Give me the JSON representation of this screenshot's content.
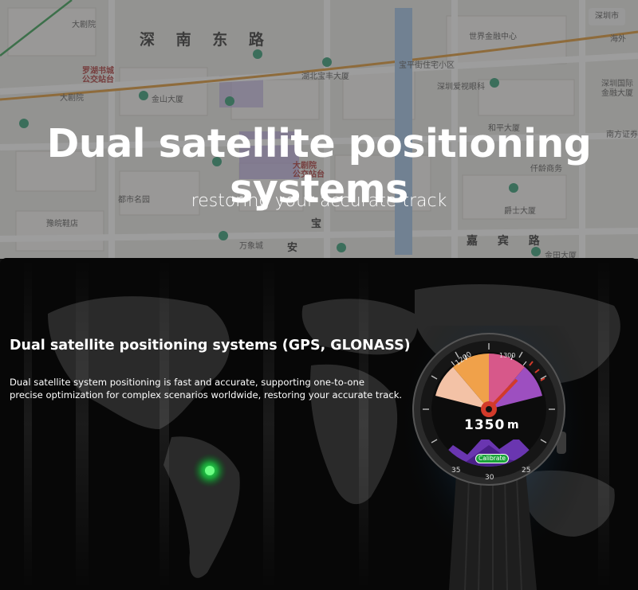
{
  "hero": {
    "title": "Dual satellite positioning systems",
    "subtitle": "restoring your accurate track",
    "map_city_button": "深圳市",
    "map_labels": {
      "road_shennan": "深 南 东 路",
      "road_jiabin": "嘉 宾 路",
      "hospital": "大剧院",
      "hospital2": "大剧院",
      "bookcity": "罗湖书城\n公交站台",
      "jinshan": "金山大厦",
      "world_finance": "世界金融中心",
      "baoping": "宝平街住宅小区",
      "hubei_baofeng": "湖北宝丰大厦",
      "shenzhen_eye": "深圳爱视眼科",
      "heping": "和平大厦",
      "qianguang": "仟龄商务",
      "wanxiang": "万象城",
      "dushi": "都市名园",
      "fuxin": "豫皖鞋店",
      "jueshi": "爵士大厦",
      "jintian": "金田大厦",
      "haiwai": "海外",
      "shenzhen_finance": "深圳国际\n金融大厦",
      "nanfang": "南方证券",
      "dajuyuan_stop": "大剧院\n公交站台",
      "bao": "宝",
      "an": "安"
    }
  },
  "section": {
    "heading": "Dual satellite positioning systems (GPS, GLONASS)",
    "description_lines": [
      "Dual satellite system positioning is fast and accurate, supporting one-to-one",
      "precise optimization for complex scenarios worldwide, restoring your accurate track."
    ]
  },
  "watch": {
    "altitude": "1350",
    "unit": "m",
    "calibrate_label": "Calibrate",
    "dial_ticks": [
      "1200",
      "1300"
    ],
    "bezel_numbers": [
      "35",
      "30",
      "25"
    ]
  },
  "colors": {
    "accent_green": "#1aa33a",
    "dial_red": "#d23a2a"
  }
}
